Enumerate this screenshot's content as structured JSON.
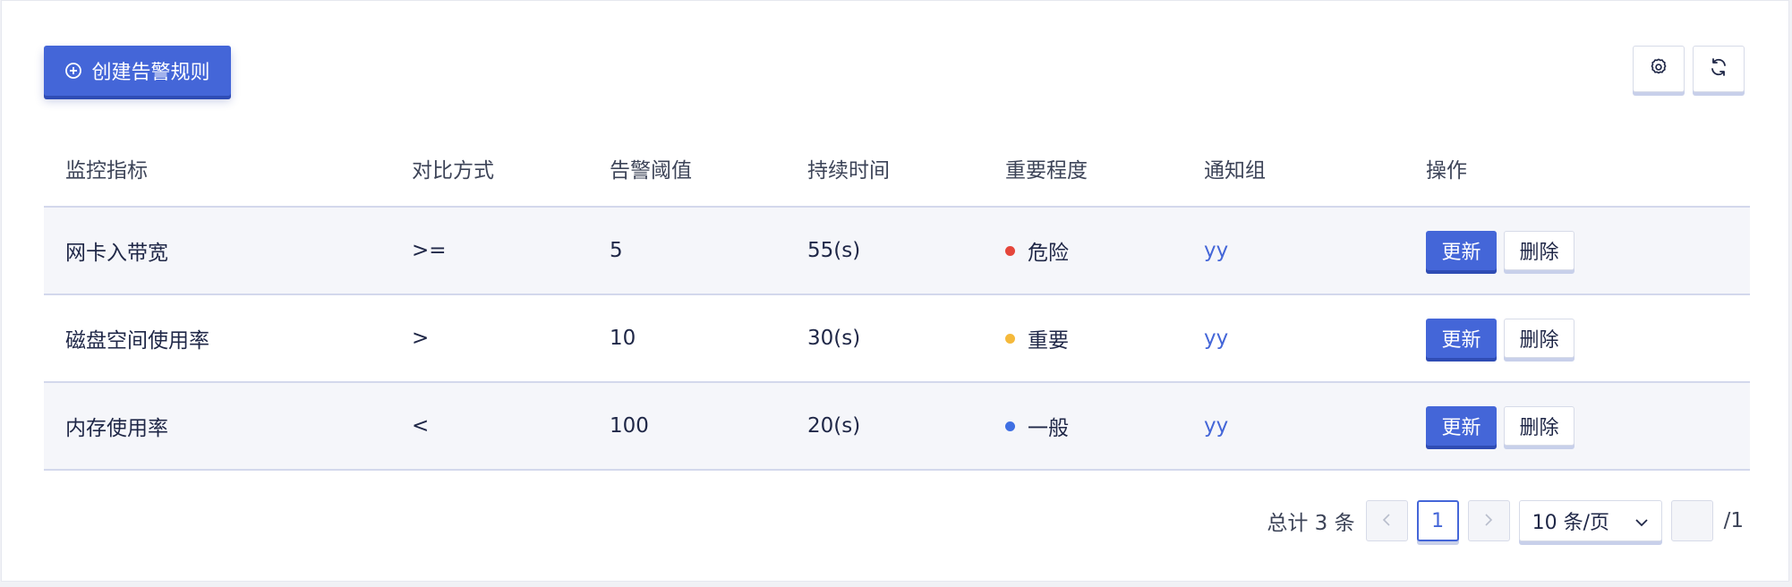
{
  "toolbar": {
    "create_label": "创建告警规则",
    "create_icon": "plus-circle-icon",
    "settings_icon": "gear-icon",
    "refresh_icon": "refresh-icon"
  },
  "table": {
    "columns": [
      "监控指标",
      "对比方式",
      "告警阈值",
      "持续时间",
      "重要程度",
      "通知组",
      "操作"
    ],
    "rows": [
      {
        "metric": "网卡入带宽",
        "compare": ">=",
        "threshold": "5",
        "duration": "55(s)",
        "level": "危险",
        "level_color": "#e5463b",
        "group": "yy",
        "update": "更新",
        "delete": "删除"
      },
      {
        "metric": "磁盘空间使用率",
        "compare": ">",
        "threshold": "10",
        "duration": "30(s)",
        "level": "重要",
        "level_color": "#f5b93b",
        "group": "yy",
        "update": "更新",
        "delete": "删除"
      },
      {
        "metric": "内存使用率",
        "compare": "<",
        "threshold": "100",
        "duration": "20(s)",
        "level": "一般",
        "level_color": "#3f6fe3",
        "group": "yy",
        "update": "更新",
        "delete": "删除"
      }
    ]
  },
  "pagination": {
    "total_text": "总计 3 条",
    "prev_icon": "chevron-left-icon",
    "current_page": "1",
    "next_icon": "chevron-right-icon",
    "page_size": "10 条/页",
    "page_size_icon": "chevron-down-icon",
    "jump_value": "",
    "total_pages": "/1"
  },
  "colors": {
    "primary": "#4466d8",
    "danger": "#e5463b",
    "important": "#f5b93b",
    "normal": "#3f6fe3"
  }
}
